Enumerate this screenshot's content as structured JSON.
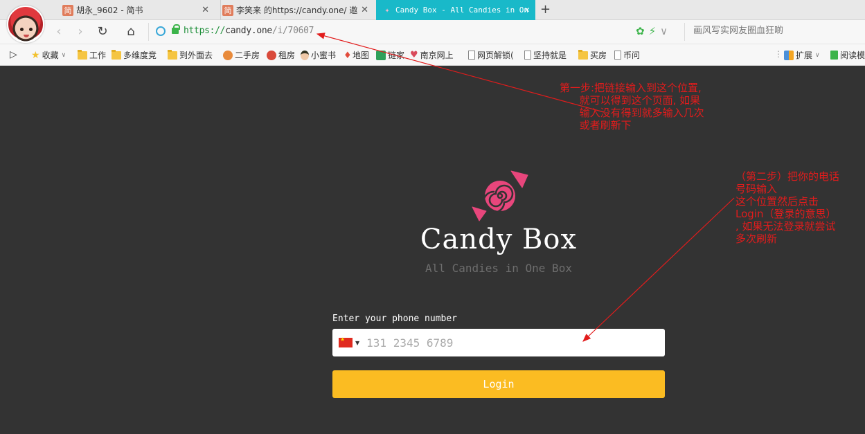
{
  "tabs": [
    {
      "favicon": "简",
      "title": "胡永_9602 - 简书",
      "close": "✕"
    },
    {
      "favicon": "简",
      "title": "李笑来 的https://candy.one/ 邀",
      "close": "✕"
    },
    {
      "favicon": "candy-icon",
      "title": "Candy Box - All Candies in On",
      "close": "✕",
      "active": true
    }
  ],
  "new_tab": "+",
  "address_bar": {
    "scheme": "https://",
    "host": "candy.one",
    "path": "/i/70607"
  },
  "search_box": {
    "text": "画风写实网友圈血狂啲"
  },
  "bookmarks": [
    {
      "label": "收藏",
      "icon": "star-icon"
    },
    {
      "label": "工作",
      "icon": "folder-icon"
    },
    {
      "label": "多维度竞",
      "icon": "folder-icon"
    },
    {
      "label": "到外面去",
      "icon": "folder-icon"
    },
    {
      "label": "二手房",
      "icon": "360-icon"
    },
    {
      "label": "租房",
      "icon": "360-icon"
    },
    {
      "label": "小蜜书",
      "icon": "face-icon"
    },
    {
      "label": "地图",
      "icon": "pin-icon"
    },
    {
      "label": "链家",
      "icon": "house-icon"
    },
    {
      "label": "南京网上",
      "icon": "heart-icon"
    },
    {
      "label": "网页解锁(",
      "icon": "doc-icon"
    },
    {
      "label": "坚持就是",
      "icon": "doc-icon"
    },
    {
      "label": "买房",
      "icon": "folder-icon"
    },
    {
      "label": "币问",
      "icon": "doc-icon"
    },
    {
      "label": "扩展",
      "icon": "extension-icon"
    },
    {
      "label": "阅读模",
      "icon": "book-icon"
    }
  ],
  "page": {
    "brand": "Candy Box",
    "tagline": "All Candies in One Box",
    "phone_label": "Enter your phone number",
    "phone_placeholder": "131 2345 6789",
    "login_label": "Login"
  },
  "annotations": {
    "step1": "第一步:把链接输入到这个位置,\n      就可以得到这个页面, 如果\n      输入没有得到就多输入几次\n      或者刷新下",
    "step2": "（第二步）把你的电话\n号码输入\n这个位置然后点击\nLogin（登录的意思）\n, 如果无法登录就尝试\n多次刷新"
  },
  "colors": {
    "page_bg": "#333333",
    "login_button": "#fbbc22",
    "active_tab": "#19b9c9",
    "annotation": "#e21c1c"
  }
}
